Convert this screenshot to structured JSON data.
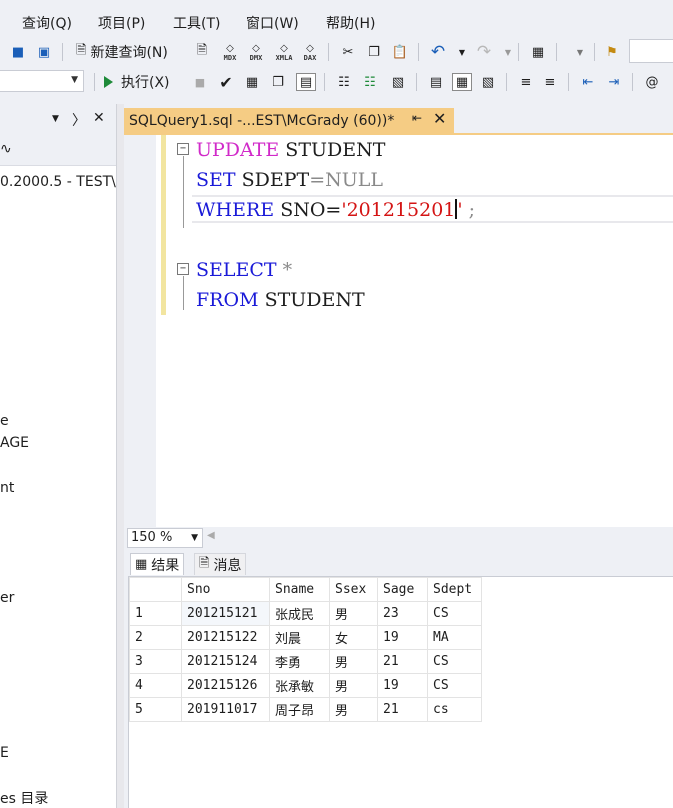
{
  "menu": {
    "query": "查询(Q)",
    "project": "项目(P)",
    "tools": "工具(T)",
    "window": "窗口(W)",
    "help": "帮助(H)"
  },
  "toolbar": {
    "new_query": "新建查询(N)",
    "execute": "执行(X)",
    "icon_caps": [
      "MDX",
      "DMX",
      "XMLA",
      "DAX"
    ]
  },
  "explorer": {
    "partial_lines": [
      "0.2000.5 - TEST\\",
      "e",
      "AGE",
      "nt",
      "er",
      "E",
      "es 目录"
    ]
  },
  "tab": {
    "title": "SQLQuery1.sql -...EST\\McGrady (60))*"
  },
  "editor": {
    "line1": {
      "kw": "UPDATE",
      "rest": " STUDENT"
    },
    "line2": {
      "kw": "SET",
      "mid": " SDEPT",
      "op": "=",
      "null": "NULL"
    },
    "line3": {
      "kw": "WHERE",
      "mid": " SNO=",
      "q1": "'",
      "val": "201215201",
      "q2": "'",
      "end": " ;"
    },
    "line5": {
      "kw": "SELECT",
      "star": " *"
    },
    "line6": {
      "kw": "FROM",
      "rest": " STUDENT"
    }
  },
  "zoom": {
    "value": "150 %"
  },
  "results_tabs": {
    "results": "结果",
    "messages": "消息"
  },
  "grid": {
    "columns": [
      "Sno",
      "Sname",
      "Ssex",
      "Sage",
      "Sdept"
    ],
    "rows": [
      {
        "n": "1",
        "Sno": "201215121",
        "Sname": "张成民",
        "Ssex": "男",
        "Sage": "23",
        "Sdept": "CS"
      },
      {
        "n": "2",
        "Sno": "201215122",
        "Sname": "刘晨",
        "Ssex": "女",
        "Sage": "19",
        "Sdept": "MA"
      },
      {
        "n": "3",
        "Sno": "201215124",
        "Sname": "李勇",
        "Ssex": "男",
        "Sage": "21",
        "Sdept": "CS"
      },
      {
        "n": "4",
        "Sno": "201215126",
        "Sname": "张承敏",
        "Ssex": "男",
        "Sage": "19",
        "Sdept": "CS"
      },
      {
        "n": "5",
        "Sno": "201911017",
        "Sname": "周子昂",
        "Ssex": "男",
        "Sage": "21",
        "Sdept": "cs"
      }
    ]
  }
}
